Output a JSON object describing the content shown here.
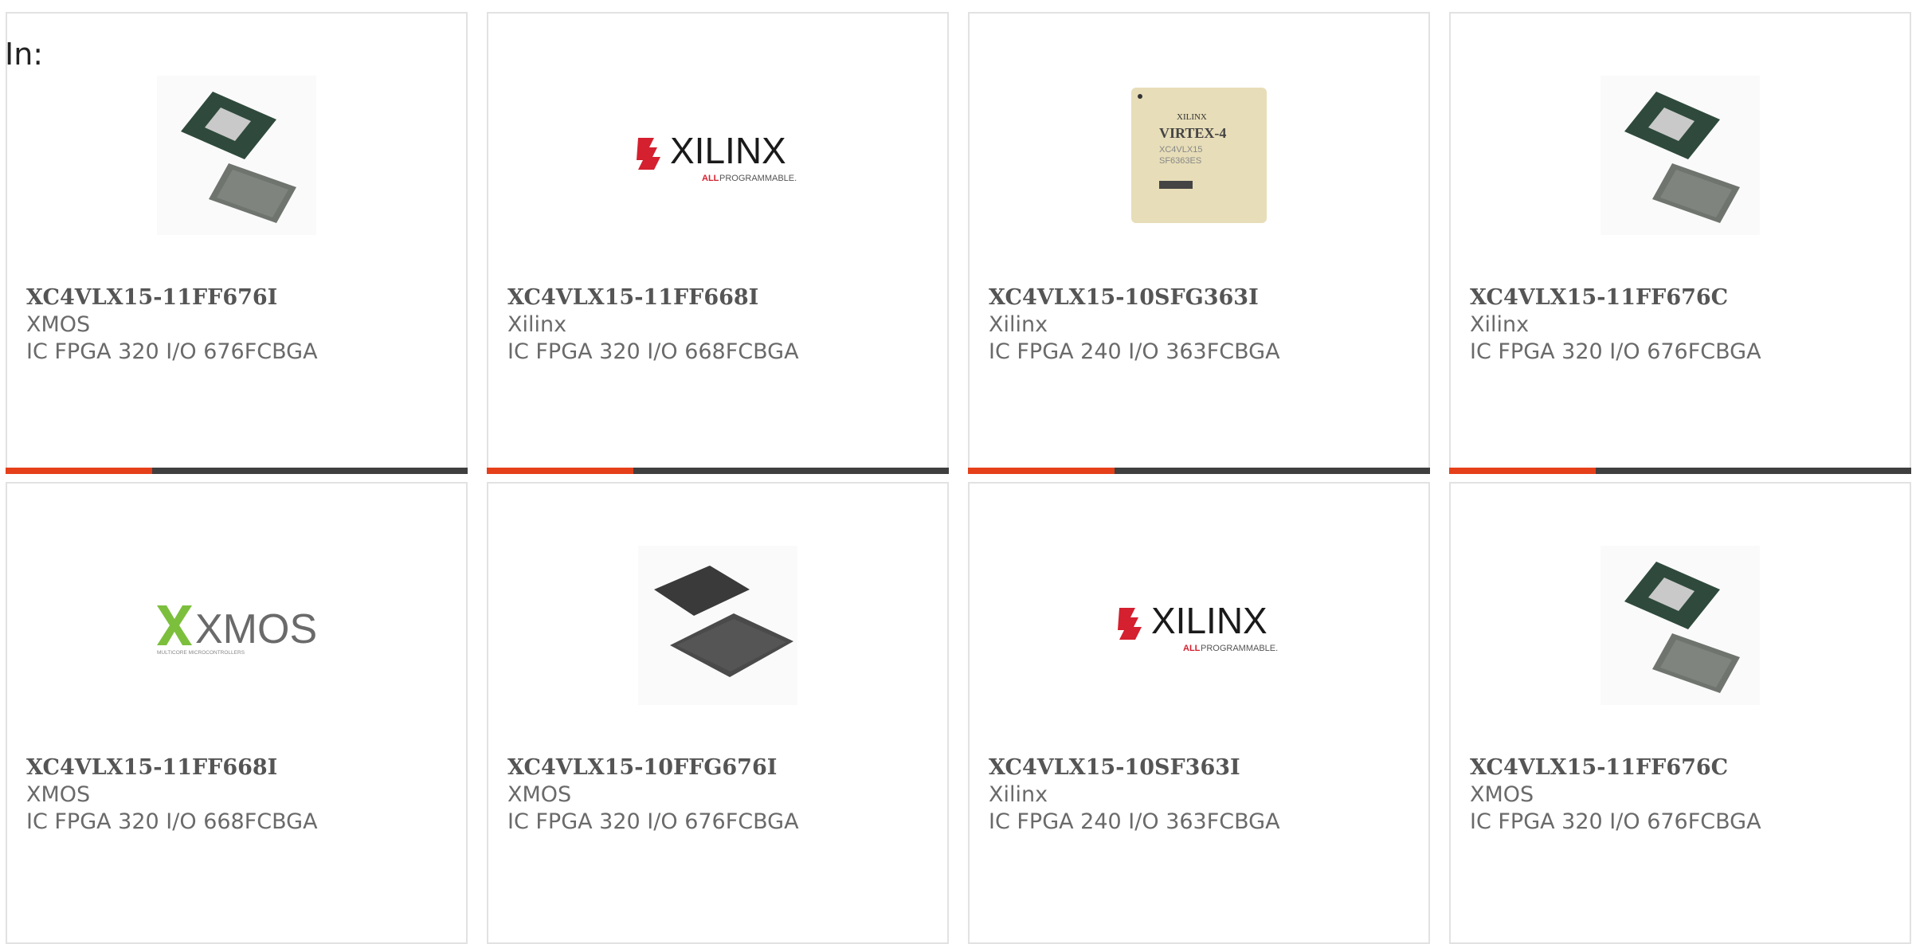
{
  "label": "In:",
  "products": [
    {
      "part": "XC4VLX15-11FF676I",
      "manufacturer": "XMOS",
      "description": "IC FPGA 320 I/O 676FCBGA",
      "image": "bga-chip-green-icon"
    },
    {
      "part": "XC4VLX15-11FF668I",
      "manufacturer": "Xilinx",
      "description": "IC FPGA 320 I/O 668FCBGA",
      "image": "xilinx-logo"
    },
    {
      "part": "XC4VLX15-10SFG363I",
      "manufacturer": "Xilinx",
      "description": "IC FPGA 240 I/O 363FCBGA",
      "image": "virtex4-chip-icon"
    },
    {
      "part": "XC4VLX15-11FF676C",
      "manufacturer": "Xilinx",
      "description": "IC FPGA 320 I/O 676FCBGA",
      "image": "bga-chip-green-icon"
    },
    {
      "part": "XC4VLX15-11FF668I",
      "manufacturer": "XMOS",
      "description": "IC FPGA 320 I/O 668FCBGA",
      "image": "xmos-logo"
    },
    {
      "part": "XC4VLX15-10FFG676I",
      "manufacturer": "XMOS",
      "description": "IC FPGA 320 I/O 676FCBGA",
      "image": "bga-chip-black-icon"
    },
    {
      "part": "XC4VLX15-10SF363I",
      "manufacturer": "Xilinx",
      "description": "IC FPGA 240 I/O 363FCBGA",
      "image": "xilinx-logo"
    },
    {
      "part": "XC4VLX15-11FF676C",
      "manufacturer": "XMOS",
      "description": "IC FPGA 320 I/O 676FCBGA",
      "image": "bga-chip-green-icon"
    }
  ],
  "logos": {
    "xilinx": {
      "name": "XILINX",
      "tagline_accent": "ALL",
      "tagline": "PROGRAMMABLE."
    },
    "xmos": {
      "name": "XMOS",
      "tagline": "MULTICORE MICROCONTROLLERS"
    },
    "virtex": {
      "brand": "XILINX",
      "family": "VIRTEX-4",
      "line1": "XC4VLX15",
      "line2": "SF6363ES"
    }
  },
  "colors": {
    "accent": "#e5401a",
    "bar": "#3f3f3f",
    "xilinx_red": "#d4202f",
    "xmos_green": "#7cbf3c"
  }
}
